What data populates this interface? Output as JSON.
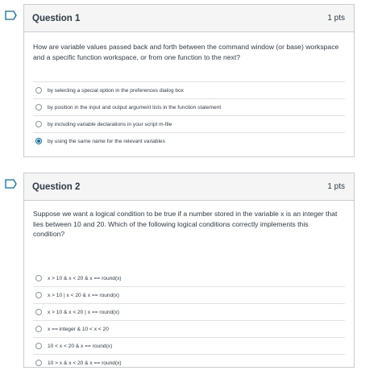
{
  "question1": {
    "title": "Question 1",
    "points": "1 pts",
    "text": "How are variable values passed back and forth between the command window (or base) workspace and a specific function workspace, or from one function to the next?",
    "answers": [
      {
        "label": "by selecting a special option in the preferences dialog box",
        "selected": false
      },
      {
        "label": "by position in the input and output argument lists in the function statement",
        "selected": false
      },
      {
        "label": "by including variable declarations in your script m-file",
        "selected": false
      },
      {
        "label": "by using the same name for the relevant variables",
        "selected": true
      }
    ]
  },
  "question2": {
    "title": "Question 2",
    "points": "1 pts",
    "text": "Suppose we want a logical condition to be true if a number stored in the variable x is an integer that lies between 10 and 20. Which of the following logical conditions correctly implements this condition?",
    "answers": [
      {
        "label": "x > 10 & x < 20 & x == round(x)",
        "selected": false
      },
      {
        "label": "x > 10 | x < 20 & x == round(x)",
        "selected": false
      },
      {
        "label": "x > 10 & x < 20 | x == round(x)",
        "selected": false
      },
      {
        "label": "x == integer & 10 < x < 20",
        "selected": false
      },
      {
        "label": "10 < x < 20 & x == round(x)",
        "selected": false
      },
      {
        "label": "10 > x & x < 20 & x == round(x)",
        "selected": false
      }
    ]
  },
  "colors": {
    "accent": "#0770a3",
    "border": "#c7cdd1",
    "header_bg": "#f5f5f5",
    "text": "#2d3b45"
  },
  "icons": {
    "flag": "flag-outline-icon",
    "radio": "radio-button-icon"
  }
}
